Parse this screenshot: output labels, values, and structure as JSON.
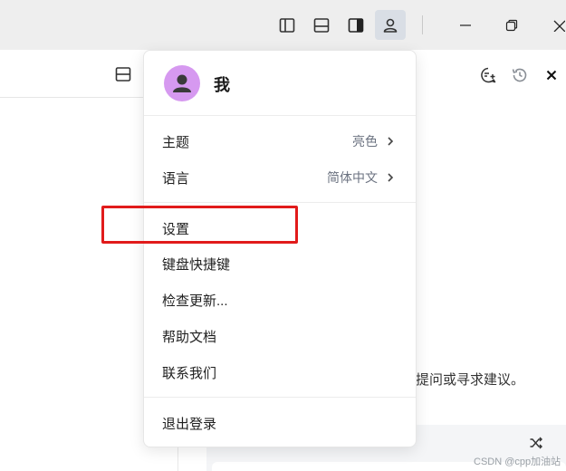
{
  "titlebar": {
    "icons": [
      "sidebar-left-icon",
      "panel-bottom-icon",
      "panel-right-icon",
      "user-icon"
    ],
    "window_controls": [
      "minimize-icon",
      "restore-icon",
      "close-icon"
    ]
  },
  "content": {
    "hint_text": "提问或寻求建议。",
    "watermark": "CSDN @cpp加油站"
  },
  "user_menu": {
    "username": "我",
    "items": [
      {
        "label": "主题",
        "value": "亮色",
        "has_submenu": true
      },
      {
        "label": "语言",
        "value": "简体中文",
        "has_submenu": true
      },
      {
        "label": "设置",
        "highlighted": true
      },
      {
        "label": "键盘快捷键"
      },
      {
        "label": "检查更新..."
      },
      {
        "label": "帮助文档"
      },
      {
        "label": "联系我们"
      },
      {
        "label": "退出登录"
      }
    ]
  },
  "colors": {
    "avatar": "#d699f0",
    "highlight_border": "#e11b1b",
    "active_button": "#d9dee5"
  }
}
